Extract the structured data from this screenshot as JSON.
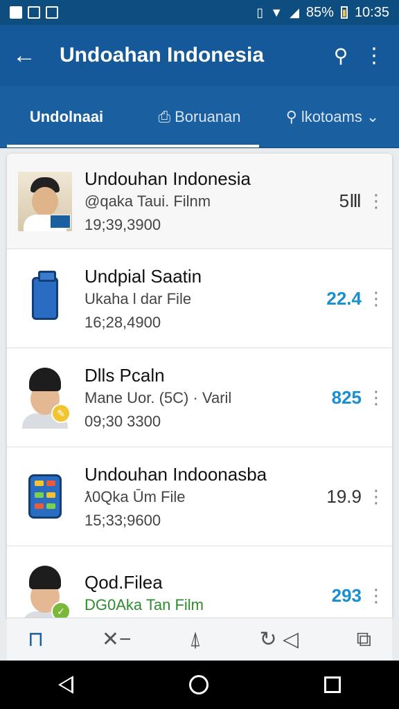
{
  "statusbar": {
    "battery": "85%",
    "time": "10:35"
  },
  "appbar": {
    "title": "Undoahan Indonesia"
  },
  "tabs": [
    {
      "label": "Undolnaai"
    },
    {
      "label": "Boruanan"
    },
    {
      "label": "lkotoams"
    }
  ],
  "list": [
    {
      "title": "Undouhan Indonesia",
      "subtitle": "@qaka Taui. Filnm",
      "meta": "19;39,3900",
      "value": "5Ⅲ"
    },
    {
      "title": "Undpial Saatin",
      "subtitle": "Ukaha l dar File",
      "meta": "16;28,4900",
      "value": "22.4"
    },
    {
      "title": "Dlls Pcaln",
      "subtitle": "Mane Uor. (5C) · Varil",
      "meta": "09;30 3300",
      "value": "825"
    },
    {
      "title": "Undouhan Indoonasba",
      "subtitle": "ƛ0Qka Ūm File",
      "meta": "15;33;9600",
      "value": "19.9"
    },
    {
      "title": "Qod.Filea",
      "subtitle": "DG0Aka Tan Film",
      "meta": "",
      "value": "293"
    }
  ],
  "colors": {
    "primary": "#15599a",
    "accent_value": "#1a8fcf"
  }
}
